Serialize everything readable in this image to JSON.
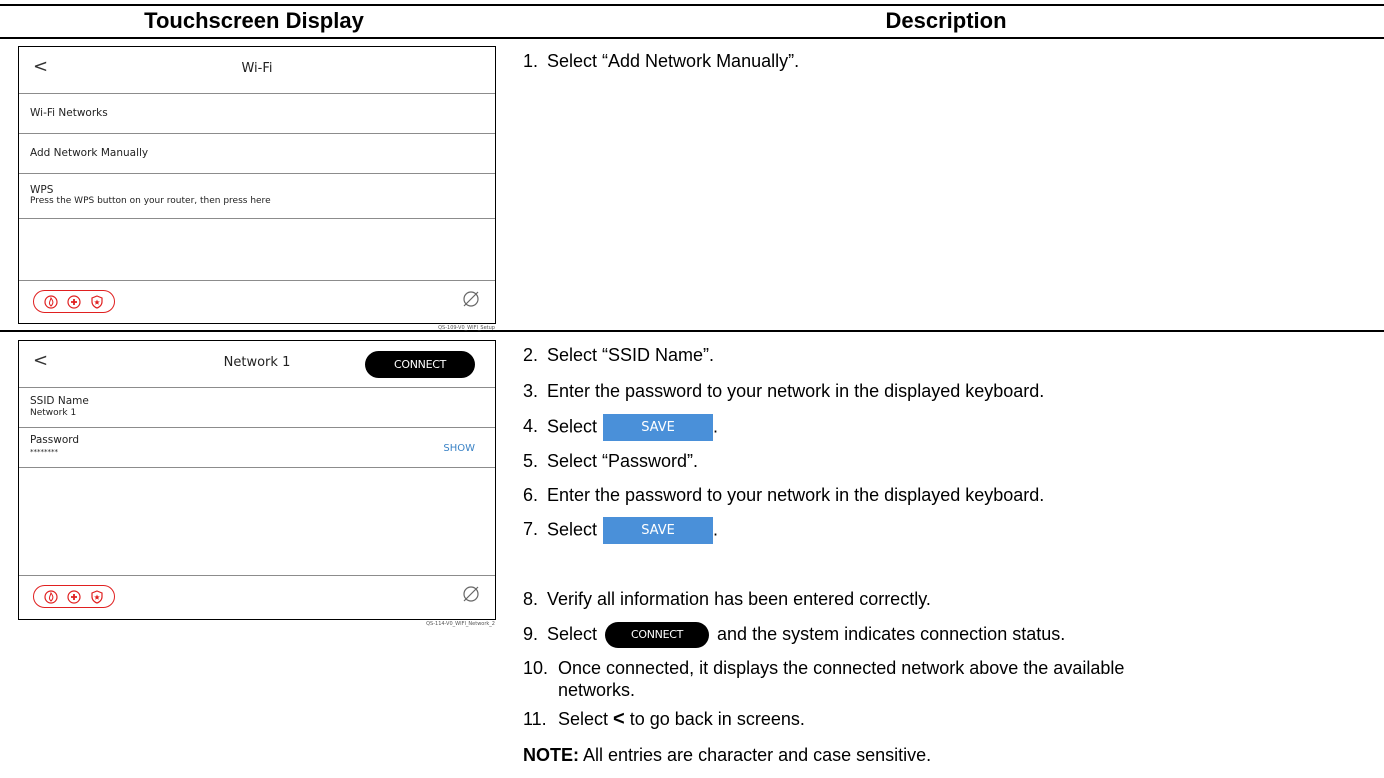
{
  "headers": {
    "left": "Touchscreen Display",
    "right": "Description"
  },
  "screen1": {
    "back_glyph": "<",
    "title": "Wi-Fi",
    "rows": [
      "Wi-Fi Networks",
      "Add Network Manually"
    ],
    "wps_title": "WPS",
    "wps_sub": "Press the WPS button on your router, then press here",
    "caption": "QS-109-V0_WIFI_Setup"
  },
  "screen2": {
    "back_glyph": "<",
    "title": "Network 1",
    "connect_label": "CONNECT",
    "ssid_label": "SSID Name",
    "ssid_value": "Network 1",
    "password_label": "Password",
    "password_value": "********",
    "show_label": "SHOW",
    "caption": "QS-114-V0_WIFI_Network_2"
  },
  "icons": {
    "footer": [
      "flame-icon",
      "medical-cross-icon",
      "police-badge-icon",
      "nfc-disabled-icon"
    ],
    "accent": "#e02020"
  },
  "steps": {
    "s1": {
      "num": "1.",
      "text": "Select “Add Network Manually”."
    },
    "s2": {
      "num": "2.",
      "text": "Select “SSID Name”."
    },
    "s3": {
      "num": "3.",
      "text": "Enter the password to your network in the displayed keyboard."
    },
    "s4": {
      "num": "4.",
      "pre": "Select",
      "button": "SAVE",
      "post": "."
    },
    "s5": {
      "num": "5.",
      "text": "Select “Password”."
    },
    "s6": {
      "num": "6.",
      "text": "Enter the password to your network in the displayed keyboard."
    },
    "s7": {
      "num": "7.",
      "pre": "Select",
      "button": "SAVE",
      "post": "."
    },
    "s8": {
      "num": "8.",
      "text": "Verify all information has been entered correctly."
    },
    "s9": {
      "num": "9.",
      "pre": "Select",
      "button": "CONNECT",
      "post": "and the system indicates connection status."
    },
    "s10": {
      "num": "10.",
      "line1": "Once connected, it displays the connected network above the available",
      "line2": "networks."
    },
    "s11": {
      "num": "11.",
      "pre": "Select",
      "glyph": "<",
      "post": "to go back in screens."
    },
    "note_label": "NOTE:",
    "note_text": "All entries are character and case sensitive."
  }
}
